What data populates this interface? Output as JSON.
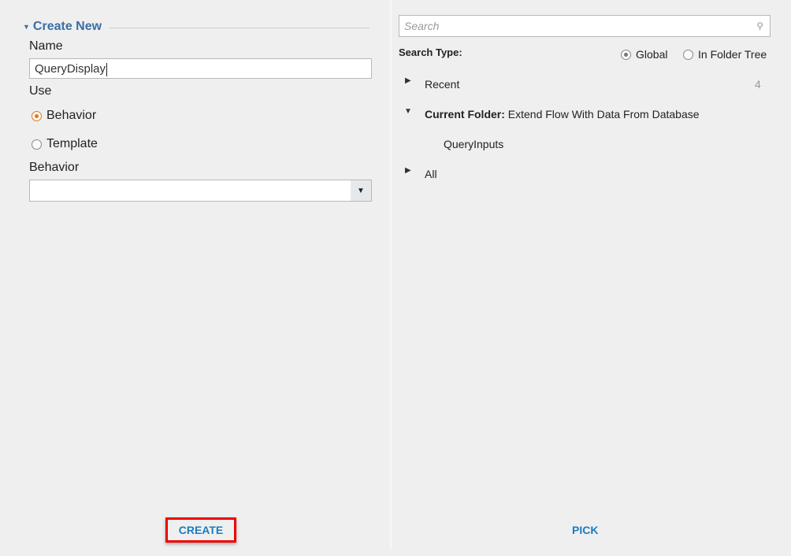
{
  "left": {
    "section_title": "Create New",
    "name_label": "Name",
    "name_value": "QueryDisplay",
    "use_label": "Use",
    "use_options": [
      {
        "label": "Behavior",
        "selected": true
      },
      {
        "label": "Template",
        "selected": false
      }
    ],
    "behavior_label": "Behavior",
    "behavior_value": "",
    "create_label": "CREATE"
  },
  "right": {
    "search_placeholder": "Search",
    "search_type_label": "Search Type:",
    "search_types": [
      {
        "label": "Global",
        "selected": true
      },
      {
        "label": "In Folder Tree",
        "selected": false
      }
    ],
    "tree": {
      "recent": {
        "label": "Recent",
        "count": "4"
      },
      "current_folder": {
        "prefix": "Current Folder:",
        "name": "Extend Flow With Data From Database",
        "items": [
          "QueryInputs"
        ]
      },
      "all": {
        "label": "All"
      }
    },
    "pick_label": "PICK"
  },
  "colors": {
    "accent": "#1a7dc0",
    "section": "#3a6ea5",
    "radio_selected": "#e07a1a",
    "highlight": "#ee0000"
  }
}
